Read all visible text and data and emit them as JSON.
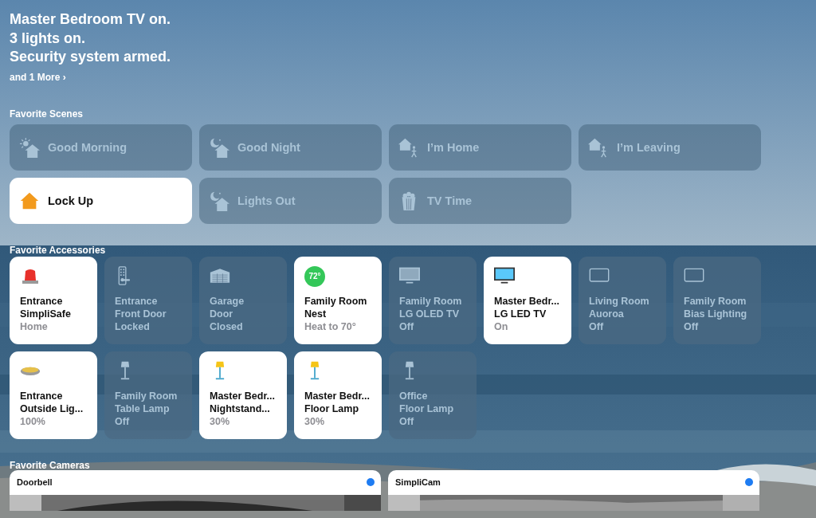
{
  "summary": {
    "lines": [
      "Master Bedroom TV on.",
      "3 lights on.",
      "Security system armed."
    ],
    "more_link": "and 1 More ›"
  },
  "scenes_section": {
    "title": "Favorite Scenes",
    "scenes": [
      {
        "name": "Good Morning",
        "on": false,
        "kind": "sunrise"
      },
      {
        "name": "Good Night",
        "on": false,
        "kind": "moon"
      },
      {
        "name": "I’m Home",
        "on": false,
        "kind": "arrive"
      },
      {
        "name": "I’m Leaving",
        "on": false,
        "kind": "arrive"
      },
      {
        "name": "Lock Up",
        "on": true,
        "kind": "house"
      },
      {
        "name": "Lights Out",
        "on": false,
        "kind": "moon"
      },
      {
        "name": "TV Time",
        "on": false,
        "kind": "popcorn"
      }
    ]
  },
  "accessories_section": {
    "title": "Favorite Accessories",
    "accessories": [
      {
        "room": "Entrance",
        "name": "SimpliSafe",
        "status": "Home",
        "on": true,
        "kind": "siren"
      },
      {
        "room": "Entrance",
        "name": "Front Door",
        "status": "Locked",
        "on": false,
        "kind": "lock"
      },
      {
        "room": "Garage",
        "name": "Door",
        "status": "Closed",
        "on": false,
        "kind": "garage"
      },
      {
        "room": "Family Room",
        "name": "Nest",
        "status": "Heat to 70°",
        "on": true,
        "kind": "thermostat",
        "reading": "72°"
      },
      {
        "room": "Family Room",
        "name": "LG OLED TV",
        "status": "Off",
        "on": false,
        "kind": "tv"
      },
      {
        "room": "Master Bedr...",
        "name": "LG LED TV",
        "status": "On",
        "on": true,
        "kind": "tv"
      },
      {
        "room": "Living Room",
        "name": "Auoroa",
        "status": "Off",
        "on": false,
        "kind": "panel"
      },
      {
        "room": "Family Room",
        "name": "Bias Lighting",
        "status": "Off",
        "on": false,
        "kind": "panel"
      },
      {
        "room": "Entrance",
        "name": "Outside Lig...",
        "status": "100%",
        "on": true,
        "kind": "disc"
      },
      {
        "room": "Family Room",
        "name": "Table Lamp",
        "status": "Off",
        "on": false,
        "kind": "lamp"
      },
      {
        "room": "Master Bedr...",
        "name": "Nightstand...",
        "status": "30%",
        "on": true,
        "kind": "lamp"
      },
      {
        "room": "Master Bedr...",
        "name": "Floor Lamp",
        "status": "30%",
        "on": true,
        "kind": "lamp"
      },
      {
        "room": "Office",
        "name": "Floor Lamp",
        "status": "Off",
        "on": false,
        "kind": "lamp"
      }
    ]
  },
  "cameras_section": {
    "title": "Favorite Cameras",
    "cameras": [
      {
        "name": "Doorbell"
      },
      {
        "name": "SimpliCam"
      }
    ]
  }
}
